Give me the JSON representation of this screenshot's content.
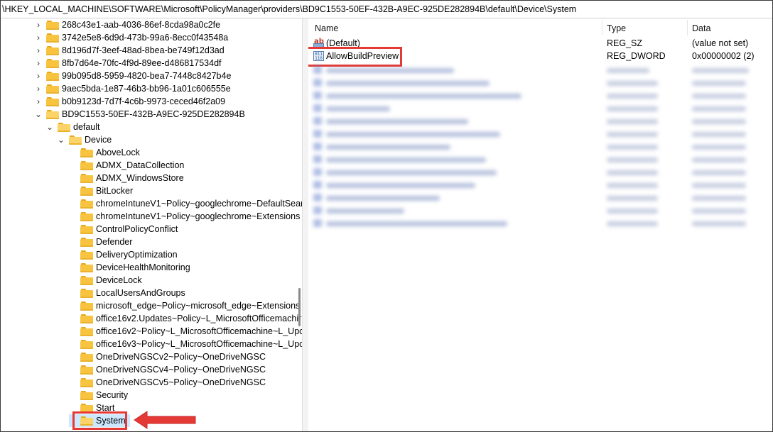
{
  "address_bar": {
    "path": "\\HKEY_LOCAL_MACHINE\\SOFTWARE\\Microsoft\\PolicyManager\\providers\\BD9C1553-50EF-432B-A9EC-925DE282894B\\default\\Device\\System"
  },
  "tree": {
    "provider_keys": [
      {
        "label": "268c43e1-aab-4036-86ef-8cda98a0c2fe"
      },
      {
        "label": "3742e5e8-6d9d-473b-99a6-8ecc0f43548a"
      },
      {
        "label": "8d196d7f-3eef-48ad-8bea-be749f12d3ad"
      },
      {
        "label": "8fb7d64e-70fc-4f9d-89ee-d486817534df"
      },
      {
        "label": "99b095d8-5959-4820-bea7-7448c8427b4e"
      },
      {
        "label": "9aec5bda-1e87-46b3-bb96-1a01c606555e"
      },
      {
        "label": "b0b9123d-7d7f-4c6b-9973-ceced46f2a09"
      }
    ],
    "expanded_provider": "BD9C1553-50EF-432B-A9EC-925DE282894B",
    "default_key": "default",
    "device_key": "Device",
    "device_children": [
      {
        "label": "AboveLock"
      },
      {
        "label": "ADMX_DataCollection"
      },
      {
        "label": "ADMX_WindowsStore"
      },
      {
        "label": "BitLocker"
      },
      {
        "label": "chromeIntuneV1~Policy~googlechrome~DefaultSear"
      },
      {
        "label": "chromeIntuneV1~Policy~googlechrome~Extensions"
      },
      {
        "label": "ControlPolicyConflict"
      },
      {
        "label": "Defender"
      },
      {
        "label": "DeliveryOptimization"
      },
      {
        "label": "DeviceHealthMonitoring"
      },
      {
        "label": "DeviceLock"
      },
      {
        "label": "LocalUsersAndGroups"
      },
      {
        "label": "microsoft_edge~Policy~microsoft_edge~Extensions"
      },
      {
        "label": "office16v2.Updates~Policy~L_MicrosoftOfficemachir"
      },
      {
        "label": "office16v2~Policy~L_MicrosoftOfficemachine~L_Upc"
      },
      {
        "label": "office16v3~Policy~L_MicrosoftOfficemachine~L_Upc"
      },
      {
        "label": "OneDriveNGSCv2~Policy~OneDriveNGSC"
      },
      {
        "label": "OneDriveNGSCv4~Policy~OneDriveNGSC"
      },
      {
        "label": "OneDriveNGSCv5~Policy~OneDriveNGSC"
      },
      {
        "label": "Security"
      },
      {
        "label": "Start"
      }
    ],
    "selected_key": "System"
  },
  "values": {
    "columns": {
      "name": "Name",
      "type": "Type",
      "data": "Data"
    },
    "rows": [
      {
        "name": "(Default)",
        "type": "REG_SZ",
        "data": "(value not set)",
        "icon": "string-value-icon"
      },
      {
        "name": "AllowBuildPreview",
        "type": "REG_DWORD",
        "data": "0x00000002 (2)",
        "icon": "dword-value-icon"
      }
    ]
  },
  "colors": {
    "highlight": "#e53935",
    "selection": "#cce8ff",
    "folder": "#f8c440"
  }
}
